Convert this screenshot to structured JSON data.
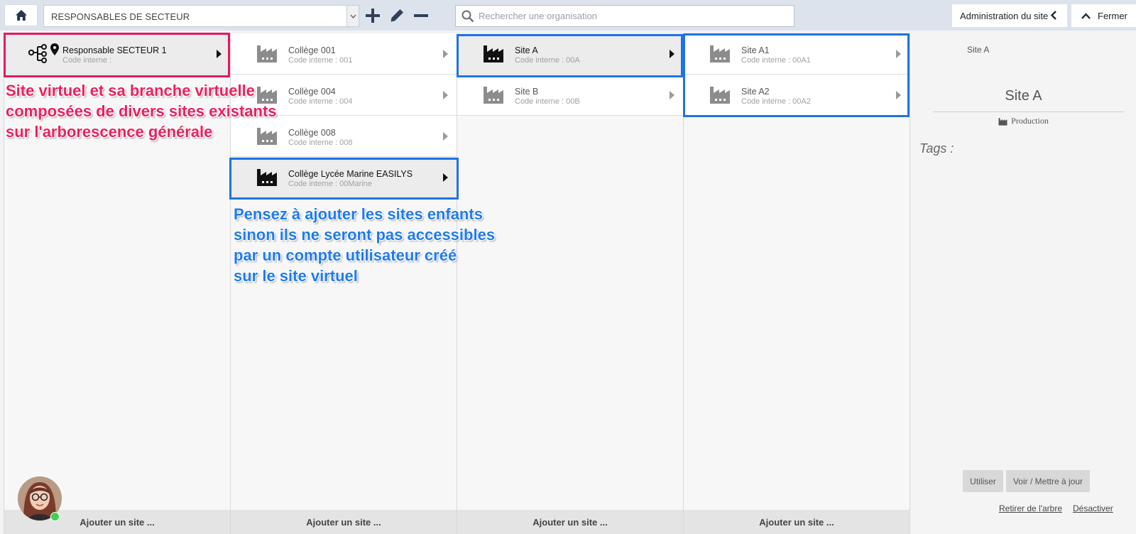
{
  "toolbar": {
    "home_icon": "home-icon",
    "selected_tree": "RESPONSABLES DE SECTEUR",
    "search_placeholder": "Rechercher une organisation",
    "admin_label": "Administration du site",
    "close_label": "Fermer"
  },
  "columns": [
    {
      "rows": [
        {
          "name": "Responsable SECTEUR 1",
          "code": "Code interne :",
          "icon": "virtual-site-icon",
          "active": true
        }
      ],
      "add_label": "Ajouter un site ..."
    },
    {
      "rows": [
        {
          "name": "Collège 001",
          "code": "Code interne : 001",
          "icon": "factory-icon",
          "active": false
        },
        {
          "name": "Collège 004",
          "code": "Code interne : 004",
          "icon": "factory-icon",
          "active": false
        },
        {
          "name": "Collège 008",
          "code": "Code interne : 008",
          "icon": "factory-icon",
          "active": false
        },
        {
          "name": "Collège Lycée Marine EASILYS",
          "code": "Code interne : 00Marine",
          "icon": "factory-icon",
          "active": true
        }
      ],
      "add_label": "Ajouter un site ..."
    },
    {
      "rows": [
        {
          "name": "Site A",
          "code": "Code interne : 00A",
          "icon": "factory-icon",
          "active": true
        },
        {
          "name": "Site B",
          "code": "Code interne : 00B",
          "icon": "factory-icon",
          "active": false
        }
      ],
      "add_label": "Ajouter un site ..."
    },
    {
      "rows": [
        {
          "name": "Site A1",
          "code": "Code interne : 00A1",
          "icon": "factory-icon",
          "active": false
        },
        {
          "name": "Site A2",
          "code": "Code interne : 00A2",
          "icon": "factory-icon",
          "active": false
        }
      ],
      "add_label": "Ajouter un site ..."
    }
  ],
  "annotations": {
    "pink": [
      "Site virtuel et sa branche virtuelle",
      "composées de divers sites existants",
      "sur l'arborescence générale"
    ],
    "blue": [
      "Pensez à ajouter les sites enfants",
      "sinon ils ne seront pas accessibles",
      "par un compte utilisateur créé",
      "sur le site virtuel"
    ]
  },
  "details": {
    "breadcrumb": "Site A",
    "title": "Site A",
    "type": "Production",
    "tags_label": "Tags :",
    "use_button": "Utiliser",
    "update_button": "Voir / Mettre à jour",
    "remove_link": "Retirer de l'arbre",
    "disable_link": "Désactiver"
  },
  "colors": {
    "pink_highlight": "#e8185e",
    "blue_highlight": "#1e73e8",
    "presence_online": "#3fd04e"
  }
}
